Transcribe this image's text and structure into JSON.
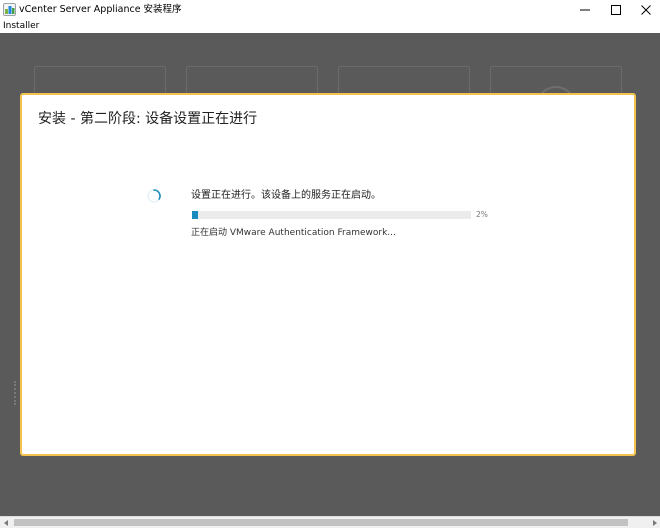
{
  "window": {
    "title": "vCenter Server Appliance 安装程序",
    "icon": "vcenter-app-icon",
    "controls": [
      "minimize-icon",
      "maximize-icon",
      "close-icon"
    ]
  },
  "menubar": {
    "items": [
      "Installer"
    ]
  },
  "modal": {
    "title": "安装 - 第二阶段: 设备设置正在进行",
    "status": "设置正在进行。该设备上的服务正在启动。",
    "progress": {
      "value": 2,
      "label": "2%"
    },
    "detail": "正在启动 VMware Authentication Framework...",
    "accent_color": "#1a8bbd",
    "border_color": "#f2c14e"
  }
}
